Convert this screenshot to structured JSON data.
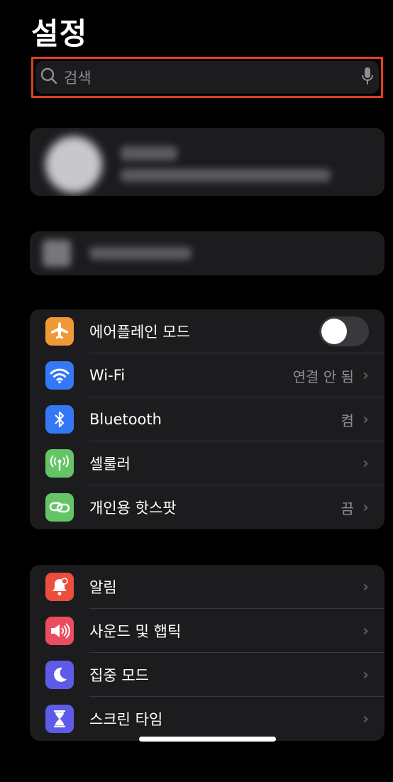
{
  "header": {
    "title": "설정"
  },
  "search": {
    "placeholder": "검색"
  },
  "connectivity": [
    {
      "label": "에어플레인 모드",
      "value": "",
      "icon": "airplane-icon",
      "color": "#f09a37"
    },
    {
      "label": "Wi-Fi",
      "value": "연결 안 됨",
      "icon": "wifi-icon",
      "color": "#3478f6"
    },
    {
      "label": "Bluetooth",
      "value": "켬",
      "icon": "bluetooth-icon",
      "color": "#3478f6"
    },
    {
      "label": "셀룰러",
      "value": "",
      "icon": "cellular-icon",
      "color": "#65c466"
    },
    {
      "label": "개인용 핫스팟",
      "value": "끔",
      "icon": "hotspot-icon",
      "color": "#65c466"
    }
  ],
  "notifications": [
    {
      "label": "알림",
      "icon": "bell-icon",
      "color": "#eb4e3d"
    },
    {
      "label": "사운드 및 햅틱",
      "icon": "speaker-icon",
      "color": "#eb4d5f"
    },
    {
      "label": "집중 모드",
      "icon": "moon-icon",
      "color": "#5e5ce6"
    },
    {
      "label": "스크린 타임",
      "icon": "hourglass-icon",
      "color": "#5e5ce6"
    }
  ],
  "airplane_mode_on": false
}
